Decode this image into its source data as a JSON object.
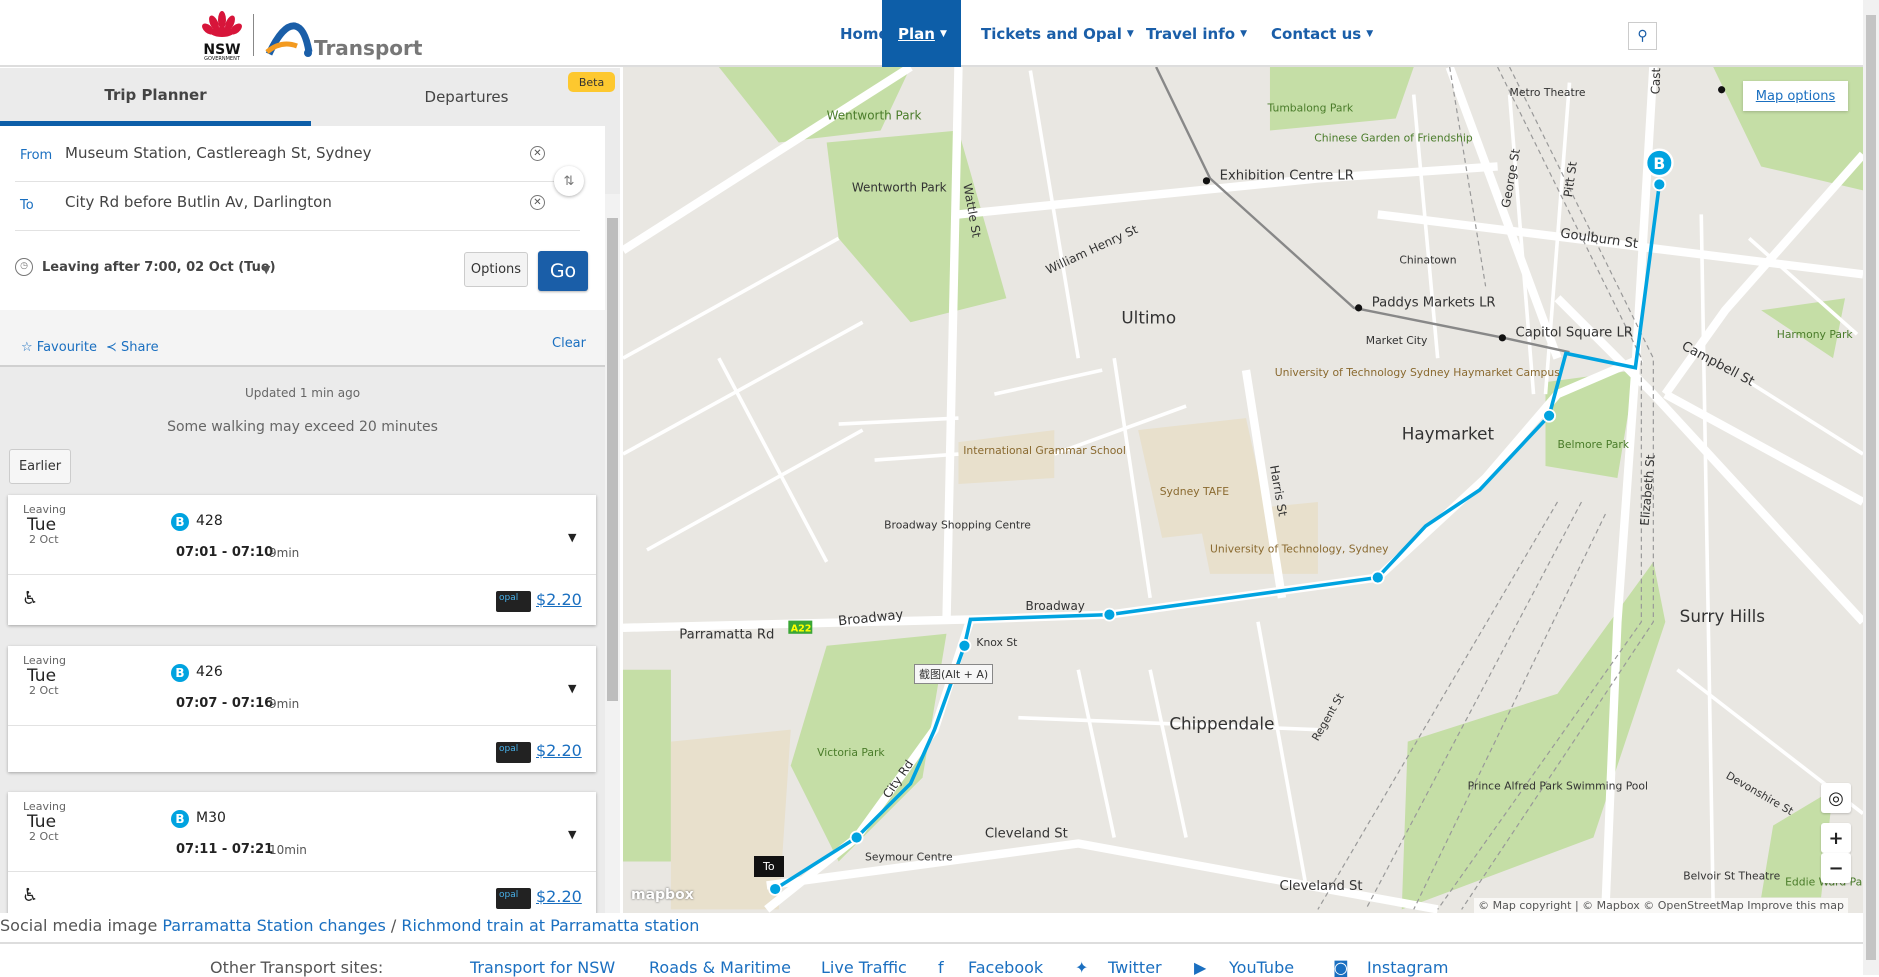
{
  "header": {
    "brand": "Transport",
    "brand_sub": "NSW",
    "gov": "GOVERNMENT",
    "nav": [
      {
        "label": "Home"
      },
      {
        "label": "Plan",
        "dropdown": true,
        "active": true
      },
      {
        "label": "Tickets and Opal",
        "dropdown": true
      },
      {
        "label": "Travel info",
        "dropdown": true
      },
      {
        "label": "Contact us",
        "dropdown": true
      }
    ],
    "search_icon": "search-icon"
  },
  "tabs": [
    {
      "label": "Trip Planner",
      "active": true
    },
    {
      "label": "Departures"
    }
  ],
  "beta": "Beta",
  "form": {
    "from_label": "From",
    "from_value": "Museum Station, Castlereagh St, Sydney",
    "to_label": "To",
    "to_value": "City Rd before Butlin Av, Darlington",
    "leaving": "Leaving after 7:00, 02 Oct (Tue)",
    "options": "Options",
    "go": "Go"
  },
  "actions": {
    "favourite": "Favourite",
    "share": "Share",
    "clear": "Clear"
  },
  "results": {
    "updated": "Updated 1 min ago",
    "walking_note": "Some walking may exceed 20 minutes",
    "earlier": "Earlier",
    "trips": [
      {
        "leaving": "Leaving",
        "day": "Tue",
        "date": "2 Oct",
        "mode": "B",
        "route": "428",
        "time": "07:01 - 07:10",
        "duration": "9min",
        "accessible": true,
        "opal": "opal",
        "fare": "$2.20"
      },
      {
        "leaving": "Leaving",
        "day": "Tue",
        "date": "2 Oct",
        "mode": "B",
        "route": "426",
        "time": "07:07 - 07:16",
        "duration": "9min",
        "accessible": false,
        "opal": "opal",
        "fare": "$2.20"
      },
      {
        "leaving": "Leaving",
        "day": "Tue",
        "date": "2 Oct",
        "mode": "B",
        "route": "M30",
        "time": "07:11 - 07:21",
        "duration": "10min",
        "accessible": true,
        "opal": "opal",
        "fare": "$2.20"
      }
    ]
  },
  "map": {
    "options": "Map options",
    "attribution": "© Map copyright | © Mapbox © OpenStreetMap Improve this map",
    "tooltip": "截图(Alt + A)",
    "to_marker": "To",
    "start_marker": "B",
    "mapbox": "mapbox",
    "route_color": "#00a3e0",
    "labels": {
      "ultimo": "Ultimo",
      "haymarket": "Haymarket",
      "chippendale": "Chippendale",
      "surry": "Surry Hills",
      "wentworth_park": "Wentworth Park",
      "wentworth_park2": "Wentworth Park",
      "exhibition": "Exhibition Centre LR",
      "paddys": "Paddys Markets LR",
      "capitol": "Capitol Square LR",
      "chinatown": "Chinatown",
      "market_city": "Market City",
      "uts": "University of Technology Sydney Haymarket Campus",
      "tafe": "Sydney TAFE",
      "uts2": "University of Technology, Sydney",
      "victoria": "Victoria Park",
      "belmore": "Belmore Park",
      "harmony": "Harmony Park",
      "tumbalong": "Tumbalong Park",
      "chinese_garden": "Chinese Garden of Friendship",
      "metro": "Metro Theatre",
      "broadway": "Broadway",
      "parramatta": "Parramatta Rd",
      "city_rd": "City Rd",
      "cleveland": "Cleveland St",
      "goulburn": "Goulburn St",
      "campbell": "Campbell St",
      "elizabeth": "Elizabeth St",
      "george": "George St",
      "pitt": "Pitt St",
      "harris": "Harris St",
      "wattle": "Wattle St",
      "william_henry": "William Henry St",
      "broadway_sc": "Broadway Shopping Centre",
      "seymour": "Seymour Centre",
      "prince_alfred": "Prince Alfred Park Swimming Pool",
      "a22": "A22",
      "castlereagh": "Castlereagh St",
      "knox": "Knox St",
      "regent": "Regent St",
      "devonshire": "Devonshire St",
      "eddie": "Eddie Ward Park",
      "belvoir": "Belvoir St Theatre",
      "intl_grammar": "International Grammar School"
    }
  },
  "footer": {
    "social_prefix": "Social media image",
    "social_link1": "Parramatta Station changes",
    "social_sep": " / ",
    "social_link2": "Richmond train at Parramatta station",
    "other_sites": "Other Transport sites:",
    "links": [
      "Transport for NSW",
      "Roads & Maritime",
      "Live Traffic",
      "Facebook",
      "Twitter",
      "YouTube",
      "Instagram"
    ]
  }
}
